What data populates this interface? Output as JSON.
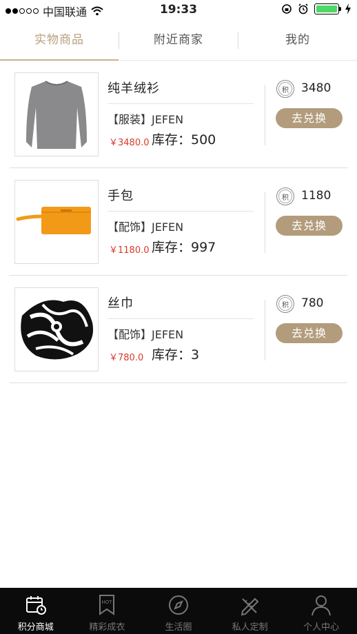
{
  "status_bar": {
    "carrier": "中国联通",
    "time": "19:33"
  },
  "tabs": [
    {
      "label": "实物商品",
      "active": true
    },
    {
      "label": "附近商家",
      "active": false
    },
    {
      "label": "我的",
      "active": false
    }
  ],
  "points_badge_label": "积",
  "items": [
    {
      "name": "纯羊绒衫",
      "brand": "【服装】JEFEN",
      "price": "￥3480.0",
      "stock": "库存：500",
      "points": "3480",
      "action": "去兑换",
      "image": "sweater"
    },
    {
      "name": "手包",
      "brand": "【配饰】JEFEN",
      "price": "￥1180.0",
      "stock": "库存：997",
      "points": "1180",
      "action": "去兑换",
      "image": "handbag"
    },
    {
      "name": "丝巾",
      "brand": "【配饰】JEFEN",
      "price": "￥780.0",
      "stock": "库存：3",
      "points": "780",
      "action": "去兑换",
      "image": "scarf"
    }
  ],
  "bottom_nav": [
    {
      "label": "积分商城",
      "icon": "calendar-clock-icon",
      "active": true
    },
    {
      "label": "精彩成衣",
      "icon": "hot-bookmark-icon",
      "active": false
    },
    {
      "label": "生活圈",
      "icon": "compass-icon",
      "active": false
    },
    {
      "label": "私人定制",
      "icon": "pencil-ruler-icon",
      "active": false
    },
    {
      "label": "个人中心",
      "icon": "person-icon",
      "active": false
    }
  ],
  "colors": {
    "accent": "#b9a07c",
    "button": "#b29c7c",
    "price": "#d83a2a",
    "nav_bg": "#0b0b0b"
  }
}
